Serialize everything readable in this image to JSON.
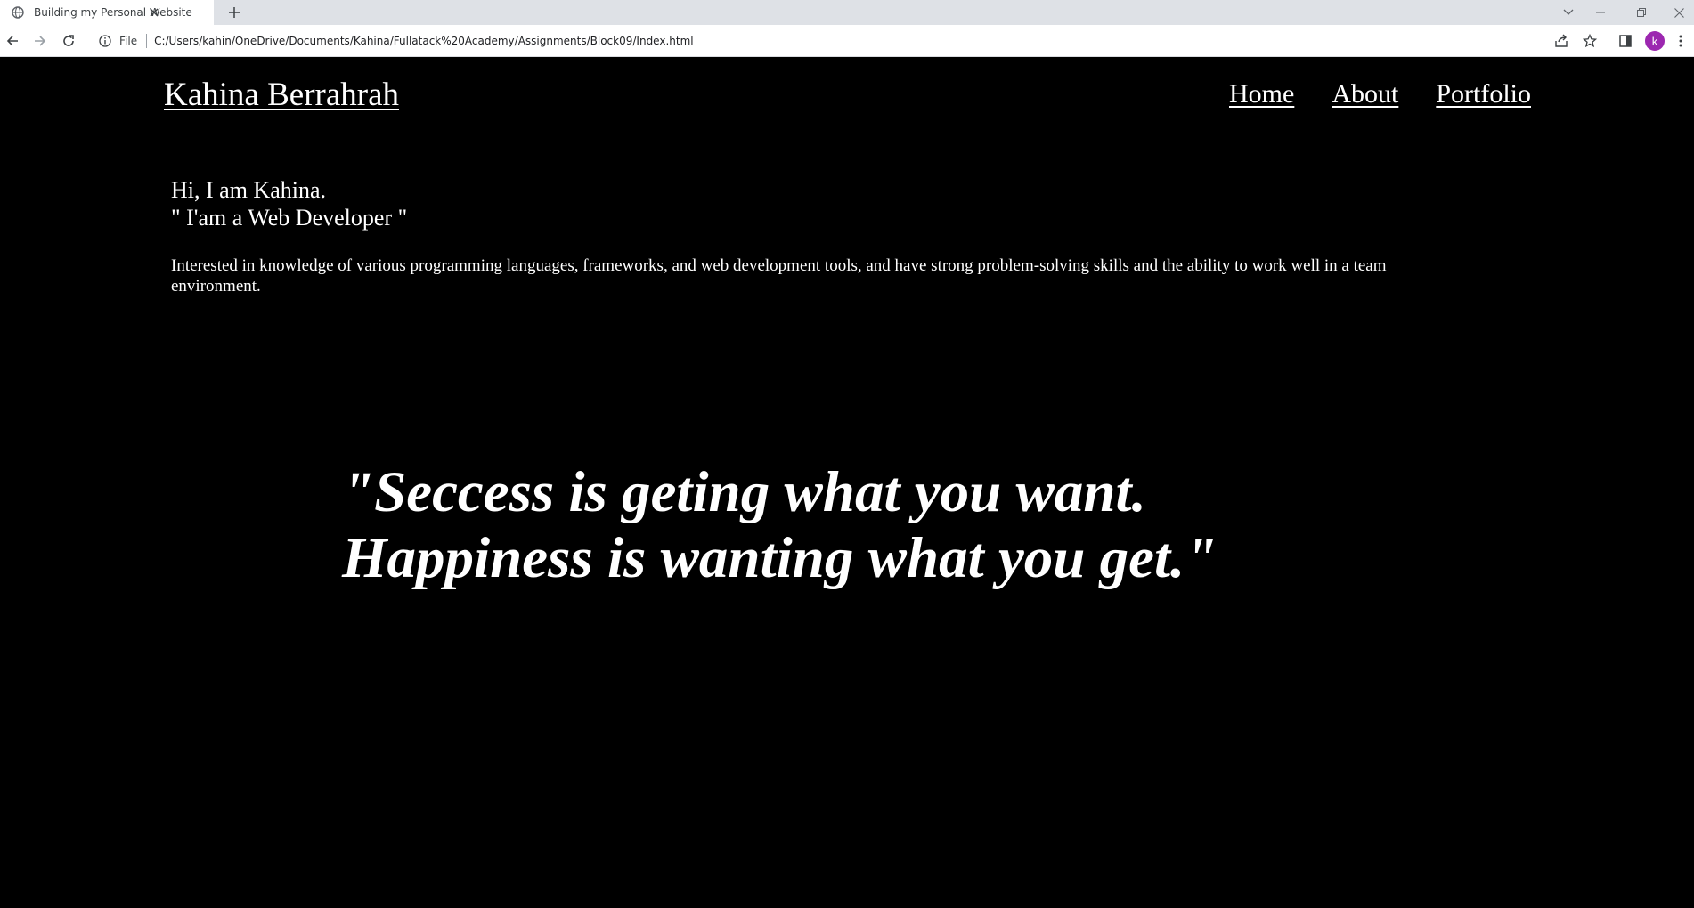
{
  "browser": {
    "tab_title": "Building my Personal Website",
    "scheme_label": "File",
    "url": "C:/Users/kahin/OneDrive/Documents/Kahina/Fullatack%20Academy/Assignments/Block09/Index.html",
    "profile_initial": "k",
    "profile_color": "#9c27b0"
  },
  "site": {
    "brand": "Kahina Berrahrah",
    "nav": [
      {
        "label": "Home"
      },
      {
        "label": "About"
      },
      {
        "label": "Portfolio"
      }
    ],
    "greeting": "Hi, I am Kahina.",
    "role": "\" I'am a Web Developer \"",
    "bio": "Interested in knowledge of various programming languages, frameworks, and web development tools, and have strong problem-solving skills and the ability to work well in a team environment.",
    "quote_line1": "\"Seccess is geting what you want.",
    "quote_line2": "Happiness is wanting what you get.\""
  },
  "colors": {
    "page_background": "#000000",
    "page_text": "#ffffff"
  }
}
